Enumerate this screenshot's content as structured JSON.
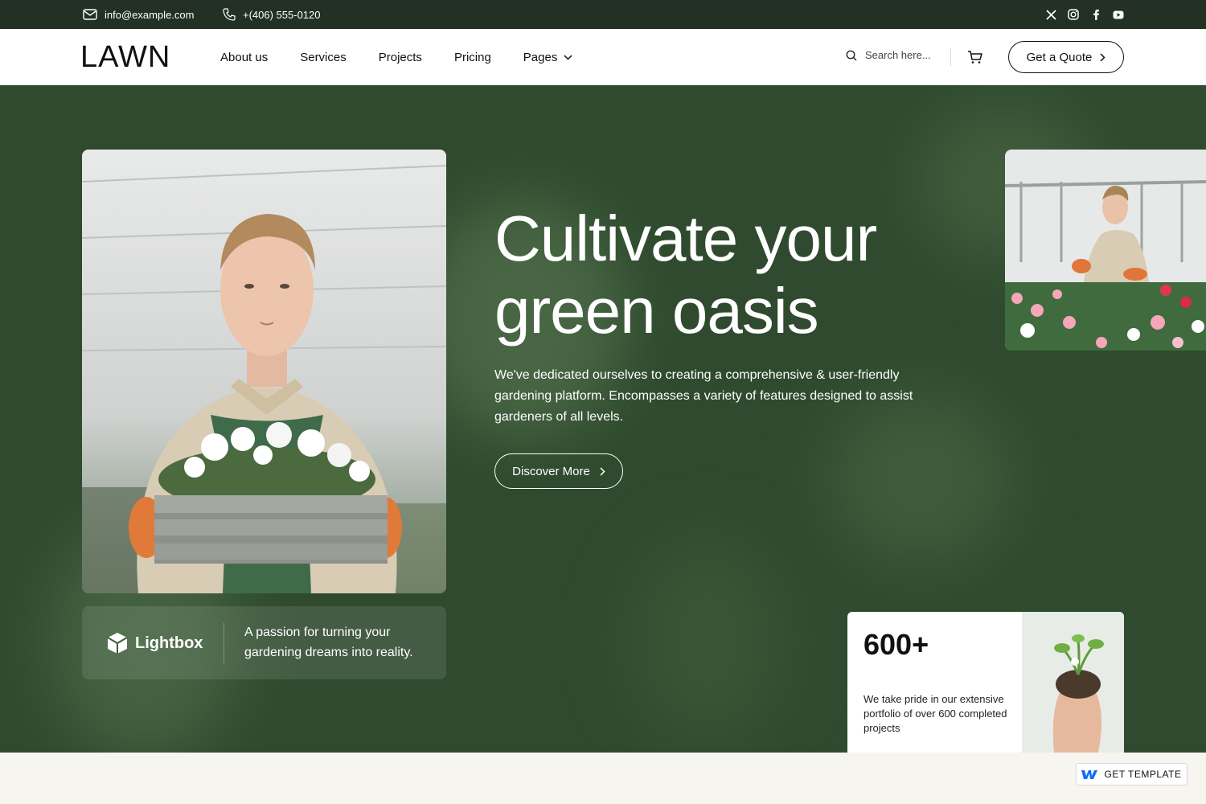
{
  "topbar": {
    "email": "info@example.com",
    "phone": "+(406) 555-0120",
    "socials": [
      "x-icon",
      "instagram-icon",
      "facebook-icon",
      "youtube-icon"
    ]
  },
  "header": {
    "logo": "LAWN",
    "nav": [
      {
        "label": "About us"
      },
      {
        "label": "Services"
      },
      {
        "label": "Projects"
      },
      {
        "label": "Pricing"
      },
      {
        "label": "Pages",
        "has_dropdown": true
      }
    ],
    "search_placeholder": "Search here...",
    "quote_label": "Get a Quote"
  },
  "hero": {
    "title": "Cultivate your green oasis",
    "subtitle": "We've dedicated ourselves to creating a comprehensive & user-friendly gardening platform. Encompasses a variety of features designed to assist gardeners of all levels.",
    "discover_label": "Discover More",
    "brand_name": "Lightbox",
    "brand_text": "A passion for turning your gardening dreams into reality."
  },
  "stat": {
    "number": "600+",
    "text": "We take pride in our extensive portfolio of over 600 completed projects"
  },
  "footer_badge": {
    "label": "GET TEMPLATE"
  },
  "colors": {
    "topbar": "#233125",
    "hero": "#2f4a2e",
    "white": "#ffffff",
    "accent_blue": "#146ef5"
  }
}
